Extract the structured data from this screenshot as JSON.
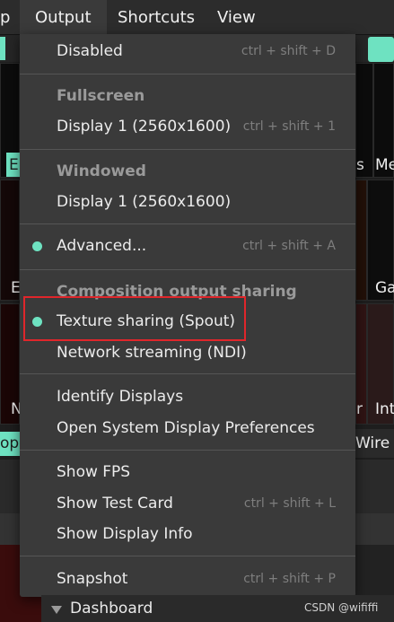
{
  "menubar": {
    "partial_left": "p",
    "items": [
      "Output",
      "Shortcuts",
      "View"
    ]
  },
  "background": {
    "labels": {
      "e1": "E",
      "s": "s",
      "me": "Me",
      "e2": "E",
      "ga": "Ga",
      "n": "N",
      "r": "r",
      "int": "Int",
      "op": "op",
      "wire": "Wire"
    },
    "dashboard": "Dashboard",
    "watermark": "CSDN @wififfi"
  },
  "output_menu": {
    "disabled": {
      "label": "Disabled",
      "shortcut": "ctrl + shift + D"
    },
    "fullscreen_header": "Fullscreen",
    "fullscreen_display": {
      "label": "Display 1 (2560x1600)",
      "shortcut": "ctrl + shift + 1"
    },
    "windowed_header": "Windowed",
    "windowed_display": {
      "label": "Display 1 (2560x1600)"
    },
    "advanced": {
      "label": "Advanced...",
      "shortcut": "ctrl + shift + A",
      "checked": true
    },
    "composition_header": "Composition output sharing",
    "texture_sharing": {
      "label": "Texture sharing (Spout)",
      "checked": true
    },
    "network_streaming": {
      "label": "Network streaming (NDI)"
    },
    "identify_displays": {
      "label": "Identify Displays"
    },
    "open_system_prefs": {
      "label": "Open System Display Preferences"
    },
    "show_fps": {
      "label": "Show FPS"
    },
    "show_test_card": {
      "label": "Show Test Card",
      "shortcut": "ctrl + shift + L"
    },
    "show_display_info": {
      "label": "Show Display Info"
    },
    "snapshot": {
      "label": "Snapshot",
      "shortcut": "ctrl + shift + P"
    }
  },
  "colors": {
    "accent": "#6ee2c1",
    "highlight_box": "#e0262b",
    "menu_bg": "#3a3a3a"
  }
}
